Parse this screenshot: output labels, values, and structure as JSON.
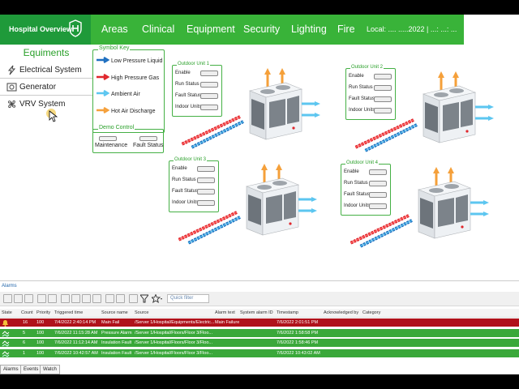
{
  "header": {
    "brand": "Hospital Overview",
    "nav": [
      "Areas",
      "Clinical",
      "Equipment",
      "Security",
      "Lighting",
      "Fire"
    ],
    "local": "Local:  .... .....2022 | ...: ...: ..."
  },
  "equipments": {
    "title": "Equiments",
    "items": [
      {
        "label": "Electrical System",
        "icon": "lightning-icon"
      },
      {
        "label": "Generator",
        "icon": "generator-icon"
      },
      {
        "label": "VRV System",
        "icon": "fan-icon"
      }
    ]
  },
  "symbol_key": {
    "title": "Symbol Key",
    "items": [
      {
        "label": "Low  Pressure Liquid",
        "color": "#1e6fc0"
      },
      {
        "label": "High Pressure Gas",
        "color": "#e0262c"
      },
      {
        "label": "Ambient Air",
        "color": "#5cc6f0"
      },
      {
        "label": "Hot Air Discharge",
        "color": "#f5a03a"
      }
    ]
  },
  "demo_control": {
    "title": "Demo Control",
    "maintenance": "Maintenance",
    "fault": "Fault Status"
  },
  "units": [
    {
      "title": "Outdoor Unit 1",
      "rows": [
        "Enable",
        "Run Status",
        "Fault Status",
        "Indoor Units"
      ]
    },
    {
      "title": "Outdoor Unit 2",
      "rows": [
        "Enable",
        "Run Status",
        "Fault Status",
        "Indoor Units"
      ]
    },
    {
      "title": "Outdoor Unit 3",
      "rows": [
        "Enable",
        "Run Status",
        "Fault Status",
        "Indoor Units"
      ]
    },
    {
      "title": "Outdoor Unit 4",
      "rows": [
        "Enable",
        "Run Status",
        "Fault Status",
        "Indoor Units"
      ]
    }
  ],
  "alarms": {
    "title": "Alarms",
    "quick_filter": "Quick filter",
    "columns": [
      "State",
      "Count",
      "Priority",
      "Triggered time",
      "Source name",
      "Source",
      "Alarm text",
      "System alarm ID",
      "Timestamp",
      "Acknowledged by",
      "Category"
    ],
    "rows": [
      {
        "count": "16",
        "priority": "100",
        "triggered": "7/4/2022 2:40:14 PM",
        "source_name": "Main Fail",
        "source": "/Server 1/Hospital/Equipments/Electric...",
        "alarm_text": "Main Failure",
        "timestamp": "7/6/2022 2:01:51 PM",
        "color": "#b0121b",
        "state_icon": "bell-icon"
      },
      {
        "count": "5",
        "priority": "100",
        "triggered": "7/6/2022 11:15:28 AM",
        "source_name": "Pressure Alarm",
        "source": "/Server 1/Hospital/Floors/Floor 3/Floo...",
        "alarm_text": "",
        "timestamp": "7/6/2022 1:58:58 PM",
        "color": "#3aa83a",
        "state_icon": "alarm-state-icon"
      },
      {
        "count": "6",
        "priority": "100",
        "triggered": "7/6/2022 11:12:14 AM",
        "source_name": "Insulation Fault",
        "source": "/Server 1/Hospital/Floors/Floor 3/Floo...",
        "alarm_text": "",
        "timestamp": "7/6/2022 1:58:46 PM",
        "color": "#3aa83a",
        "state_icon": "alarm-state-icon"
      },
      {
        "count": "1",
        "priority": "100",
        "triggered": "7/6/2022 10:42:57 AM",
        "source_name": "Insulation Fault",
        "source": "/Server 1/Hospital/Floors/Floor 3/Floo...",
        "alarm_text": "",
        "timestamp": "7/6/2022 10:43:02 AM",
        "color": "#3aa83a",
        "state_icon": "alarm-state-icon"
      }
    ],
    "tabs": [
      "Alarms",
      "Events",
      "Watch"
    ]
  }
}
